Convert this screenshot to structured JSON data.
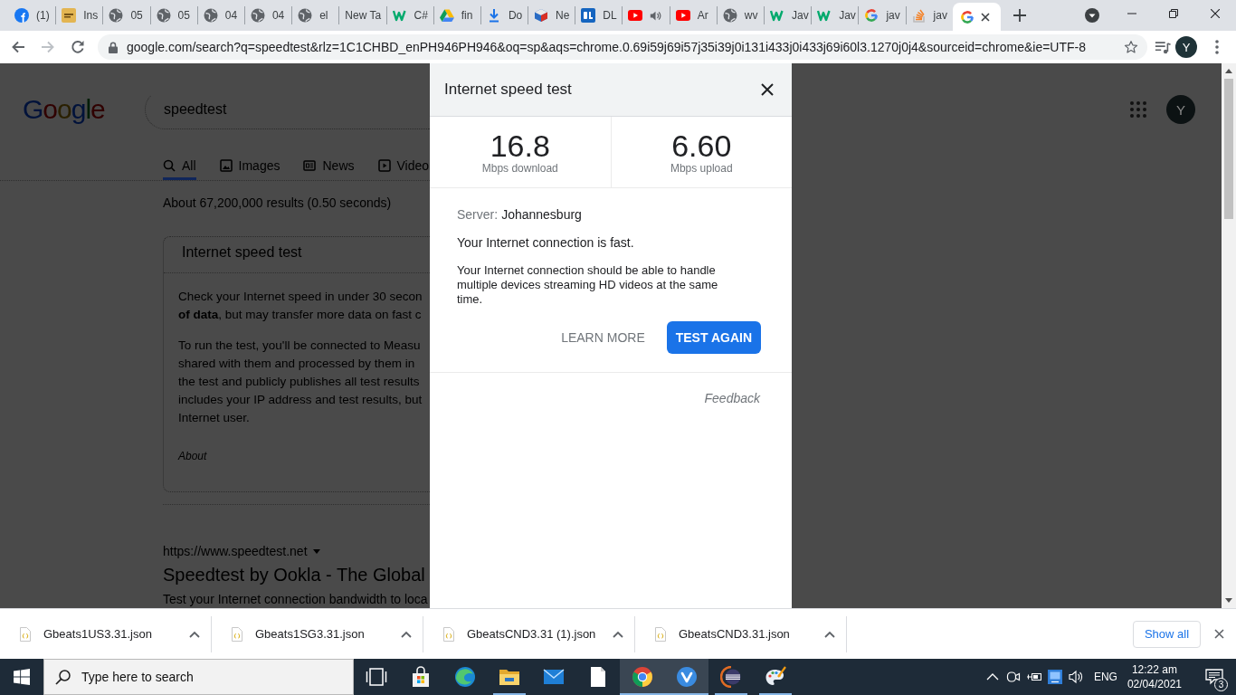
{
  "browser": {
    "tabs": [
      {
        "kind": "facebook",
        "label": "(1)",
        "audio": false,
        "selected": false
      },
      {
        "kind": "square",
        "label": "Ins",
        "audio": false,
        "selected": false
      },
      {
        "kind": "globe",
        "label": "05",
        "audio": false,
        "selected": false
      },
      {
        "kind": "globe",
        "label": "05",
        "audio": false,
        "selected": false
      },
      {
        "kind": "globe",
        "label": "04",
        "audio": false,
        "selected": false
      },
      {
        "kind": "globe",
        "label": "04",
        "audio": false,
        "selected": false
      },
      {
        "kind": "globe",
        "label": "el",
        "audio": false,
        "selected": false
      },
      {
        "kind": "blank",
        "label": "New Ta",
        "audio": false,
        "selected": false
      },
      {
        "kind": "w3",
        "label": "C#",
        "audio": false,
        "selected": false
      },
      {
        "kind": "drive",
        "label": "fin",
        "audio": false,
        "selected": false
      },
      {
        "kind": "download",
        "label": "Do",
        "audio": false,
        "selected": false
      },
      {
        "kind": "cube",
        "label": "Ne",
        "audio": false,
        "selected": false
      },
      {
        "kind": "dl",
        "label": "DL",
        "audio": false,
        "selected": false
      },
      {
        "kind": "youtube",
        "audio": true,
        "selected": false
      },
      {
        "kind": "youtube",
        "label": "Ar",
        "audio": false,
        "selected": false
      },
      {
        "kind": "globe",
        "label": "wv",
        "audio": false,
        "selected": false
      },
      {
        "kind": "w3",
        "label": "Jav",
        "audio": false,
        "selected": false
      },
      {
        "kind": "w3",
        "label": "Jav",
        "audio": false,
        "selected": false
      },
      {
        "kind": "google",
        "label": "jav",
        "audio": false,
        "selected": false
      },
      {
        "kind": "stack",
        "label": "jav",
        "audio": false,
        "selected": false
      },
      {
        "kind": "google",
        "audio": false,
        "selected": true
      }
    ],
    "toolbar": {
      "back_disabled": false,
      "forward_disabled": true,
      "url": "google.com/search?q=speedtest&rlz=1C1CHBD_enPH946PH946&oq=sp&aqs=chrome.0.69i59j69i57j35i39j0i131i433j0i433j69i60l3.1270j0j4&sourceid=chrome&ie=UTF-8",
      "profile": "Y"
    }
  },
  "page": {
    "logo": "Google",
    "query": "speedtest",
    "nav": [
      {
        "kind": "all",
        "label": "All",
        "selected": true
      },
      {
        "kind": "images",
        "label": "Images",
        "selected": false
      },
      {
        "kind": "news",
        "label": "News",
        "selected": false
      },
      {
        "kind": "videos",
        "label": "Video",
        "selected": false
      }
    ],
    "result_stats": "About 67,200,000 results (0.50 seconds)",
    "card": {
      "title": "Internet speed test",
      "paragraphs": [
        [
          "Check your Internet speed in under 30 secon",
          "**of data**, but may transfer more data on fast c"
        ],
        [
          "To run the test, you'll be connected to Measu",
          "shared with them and processed by them in",
          "the test and publicly publishes all test results",
          "includes your IP address and test results, but",
          "Internet user."
        ]
      ],
      "about": "About"
    },
    "result": {
      "url": "https://www.speedtest.net",
      "title": "Speedtest by Ookla - The Global",
      "snippet": "Test your Internet connection bandwidth to loca"
    },
    "avatar": "Y"
  },
  "dialog": {
    "title": "Internet speed test",
    "stats": [
      {
        "value": "16.8",
        "unit": "Mbps download"
      },
      {
        "value": "6.60",
        "unit": "Mbps upload"
      }
    ],
    "server_label": "Server:",
    "server": "Johannesburg",
    "verdict": "Your Internet connection is fast.",
    "detail": "Your Internet connection should be able to handle multiple devices streaming HD videos at the same time.",
    "learn_more": "LEARN MORE",
    "test_again": "TEST AGAIN",
    "feedback": "Feedback"
  },
  "downloads": {
    "items": [
      {
        "name": "Gbeats1US3.31.json"
      },
      {
        "name": "Gbeats1SG3.31.json"
      },
      {
        "name": "GbeatsCND3.31 (1).json"
      },
      {
        "name": "GbeatsCND3.31.json"
      }
    ],
    "show_all": "Show all"
  },
  "taskbar": {
    "search": {
      "placeholder": "Type here to search"
    },
    "apps": [
      {
        "kind": "task-view",
        "active": false,
        "running": false
      },
      {
        "kind": "store",
        "active": false,
        "running": false
      },
      {
        "kind": "edge",
        "active": false,
        "running": false
      },
      {
        "kind": "explorer",
        "active": false,
        "running": true
      },
      {
        "kind": "mail",
        "active": false,
        "running": false
      },
      {
        "kind": "notepad",
        "active": false,
        "running": false
      },
      {
        "kind": "chrome",
        "active": true,
        "running": true
      },
      {
        "kind": "vivaldi",
        "active": true,
        "running": true
      },
      {
        "kind": "eclipse",
        "active": false,
        "running": true
      },
      {
        "kind": "paint",
        "active": false,
        "running": true
      }
    ],
    "language": "ENG",
    "time": "12:22 am",
    "date": "02/04/2021",
    "notifications": "3"
  }
}
